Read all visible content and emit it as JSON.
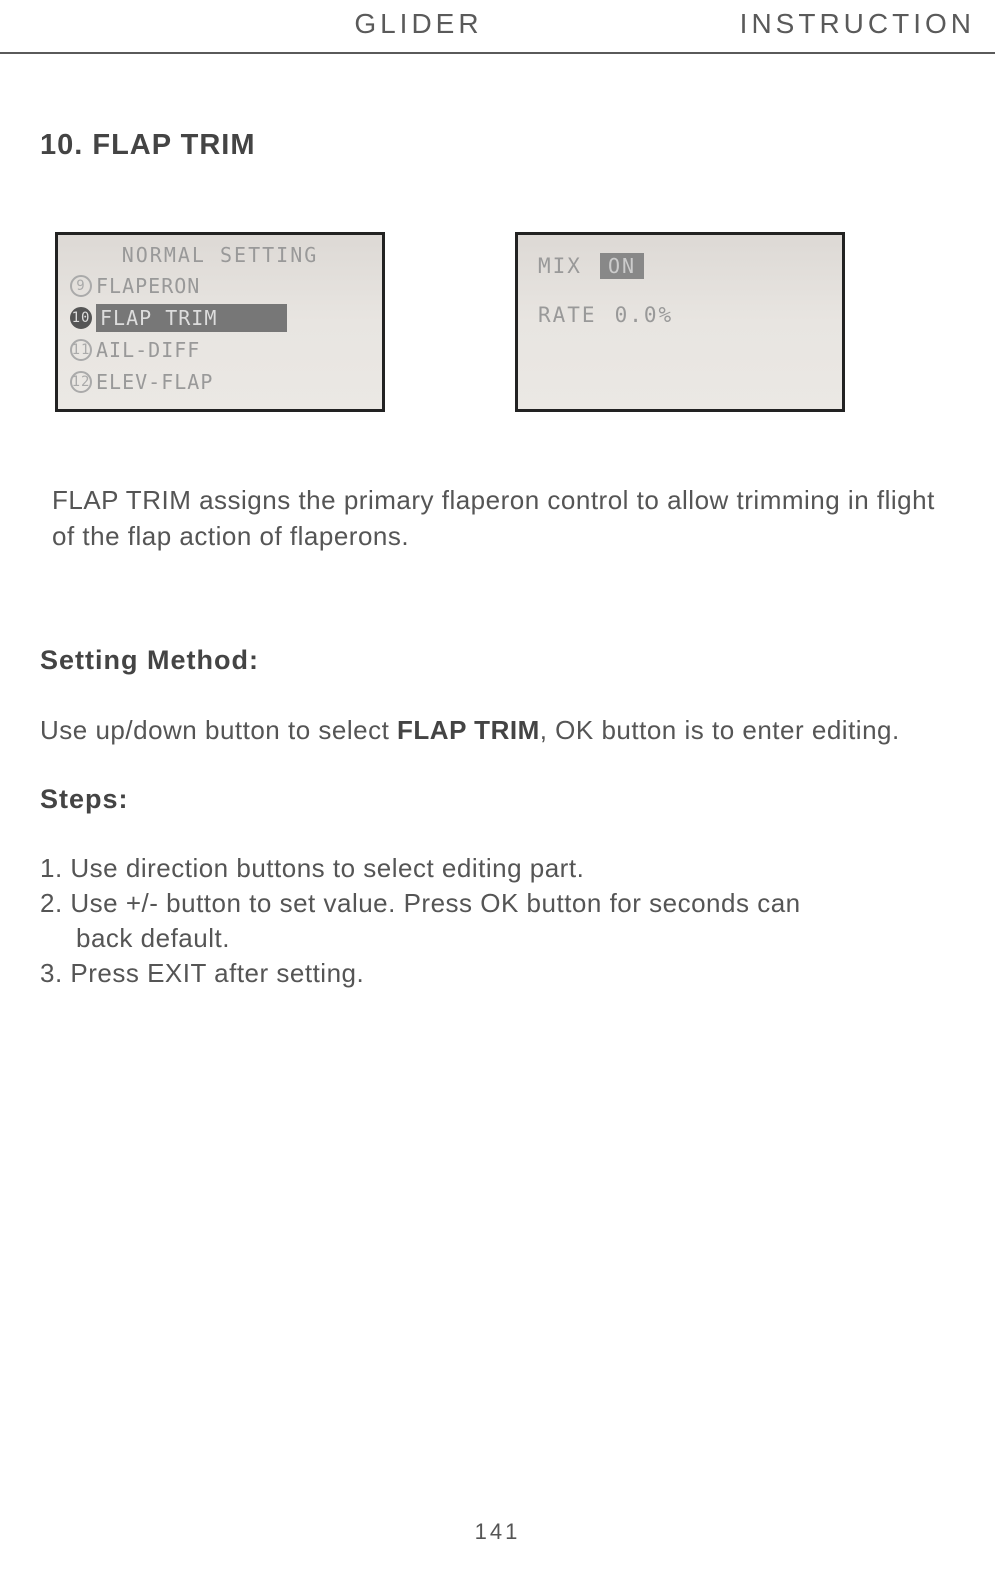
{
  "header": {
    "left": "GLIDER",
    "right": "INSTRUCTION"
  },
  "section_title": "10. FLAP TRIM",
  "screen1": {
    "title": "NORMAL SETTING",
    "items": [
      {
        "num": "9",
        "label": "FLAPERON",
        "selected": false
      },
      {
        "num": "10",
        "label": "FLAP TRIM",
        "selected": true
      },
      {
        "num": "11",
        "label": "AIL-DIFF",
        "selected": false
      },
      {
        "num": "12",
        "label": "ELEV-FLAP",
        "selected": false
      }
    ]
  },
  "screen2": {
    "mix_label": "MIX",
    "mix_value": "ON",
    "rate_label": "RATE",
    "rate_value": "0.0%"
  },
  "description": "FLAP TRIM assigns the primary flaperon control to allow trimming in flight of the flap action of flaperons.",
  "setting_method_title": "Setting Method:",
  "setting_method_text_prefix": "Use up/down button to select ",
  "setting_method_text_bold": "FLAP TRIM",
  "setting_method_text_suffix": ", OK button is to enter editing.",
  "steps_title": "Steps:",
  "steps": {
    "s1": "1. Use direction buttons to select editing part.",
    "s2a": "2. Use +/- button to set value. Press OK button for seconds can",
    "s2b": "back default.",
    "s3": "3. Press EXIT after setting."
  },
  "page_number": "141"
}
